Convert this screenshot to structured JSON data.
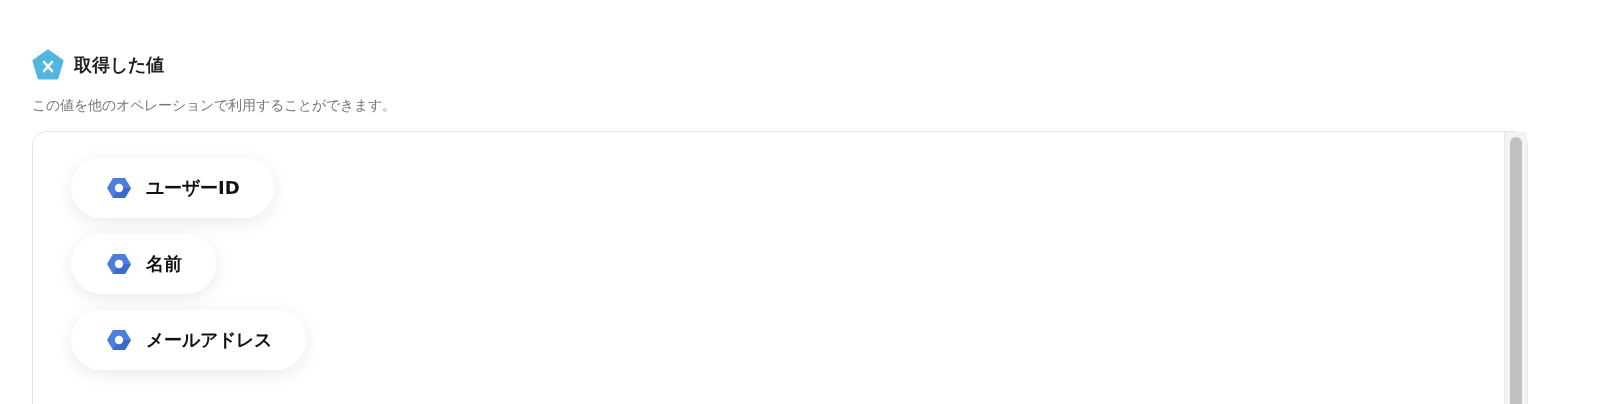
{
  "header": {
    "title": "取得した値",
    "description": "この値を他のオペレーションで利用することができます。"
  },
  "values": [
    {
      "label": "ユーザーID"
    },
    {
      "label": "名前"
    },
    {
      "label": "メールアドレス"
    }
  ]
}
